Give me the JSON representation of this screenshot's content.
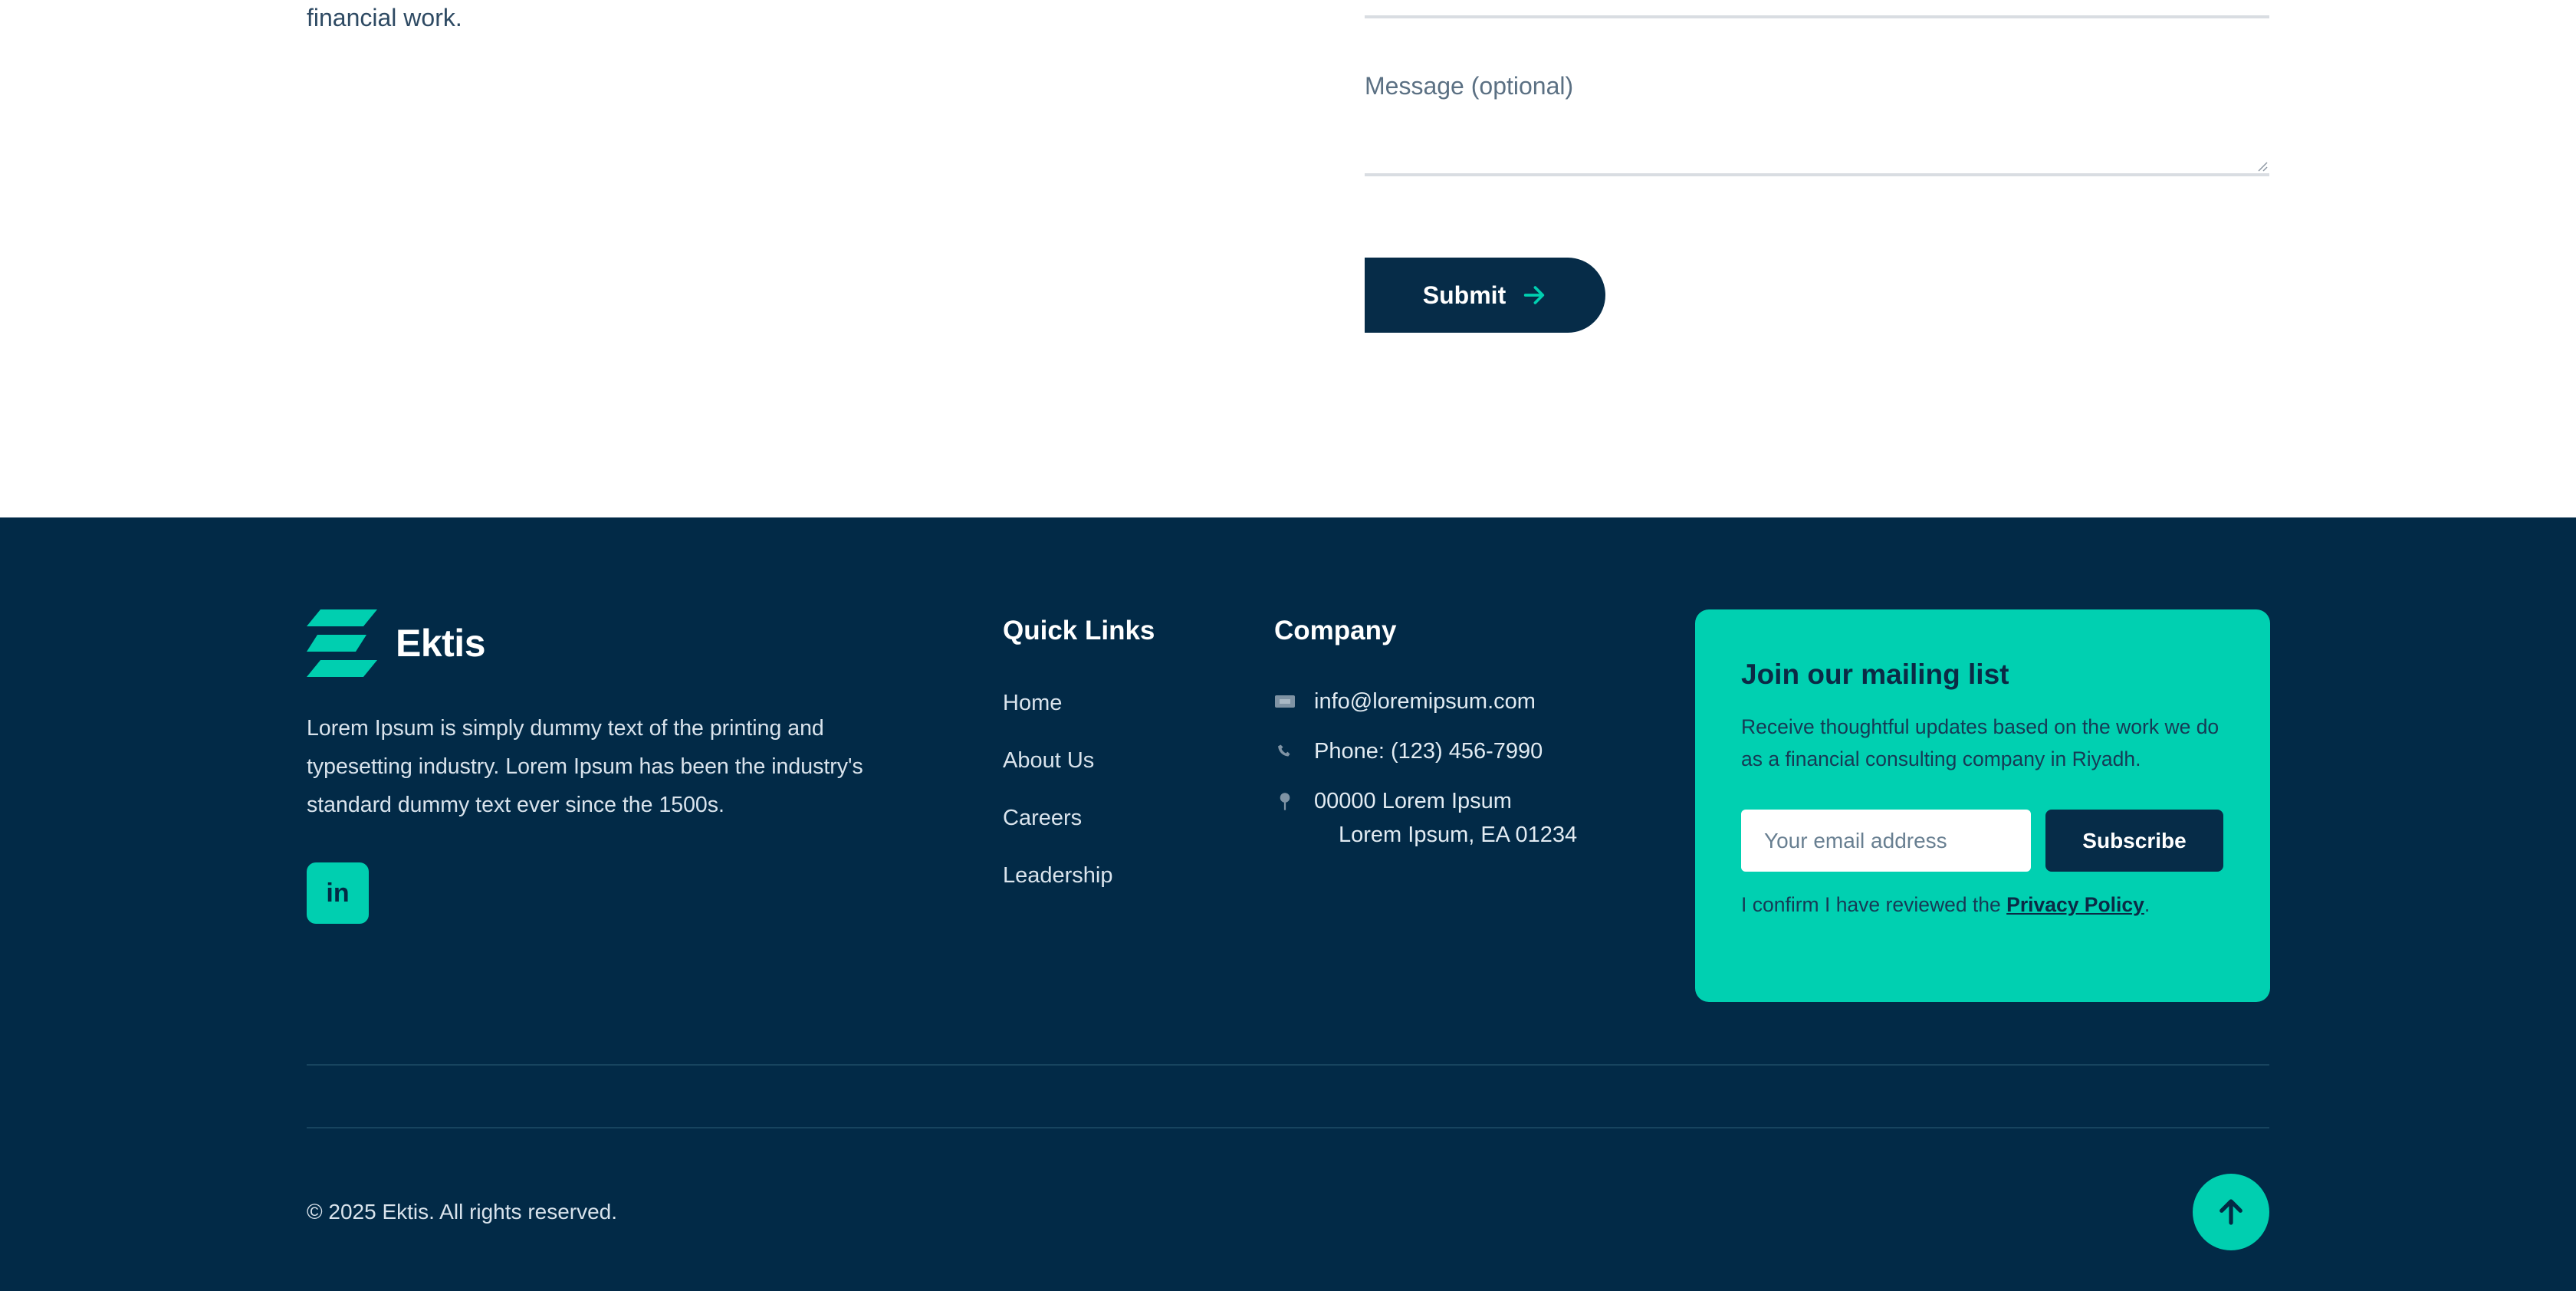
{
  "contact": {
    "intro_tail": "financial work.",
    "message_label": "Message (optional)",
    "submit_label": "Submit"
  },
  "footer": {
    "brand_name": "Ektis",
    "description": "Lorem Ipsum is simply dummy text of the printing and typesetting industry. Lorem Ipsum has been the industry's standard dummy text ever since the 1500s.",
    "linkedin_label": "in",
    "quick_links": {
      "title": "Quick Links",
      "items": [
        "Home",
        "About Us",
        "Careers",
        "Leadership"
      ]
    },
    "company": {
      "title": "Company",
      "email": "info@loremipsum.com",
      "phone": "Phone: (123) 456-7990",
      "address_line1": "00000 Lorem Ipsum",
      "address_line2": "Lorem Ipsum, EA 01234"
    },
    "mailing": {
      "title": "Join our mailing list",
      "description": "Receive thoughtful updates based on the work we do as a financial consulting company in Riyadh.",
      "email_placeholder": "Your email address",
      "subscribe_label": "Subscribe",
      "consent_prefix": "I confirm I have reviewed the ",
      "privacy_label": "Privacy Policy",
      "consent_suffix": "."
    },
    "copyright": "© 2025 Ektis. All rights reserved."
  },
  "colors": {
    "navy": "#022a47",
    "accent": "#00cfb0"
  },
  "icons": [
    "arrow-right-icon",
    "linkedin-icon",
    "email-icon",
    "phone-icon",
    "location-pin-icon",
    "arrow-up-icon"
  ]
}
